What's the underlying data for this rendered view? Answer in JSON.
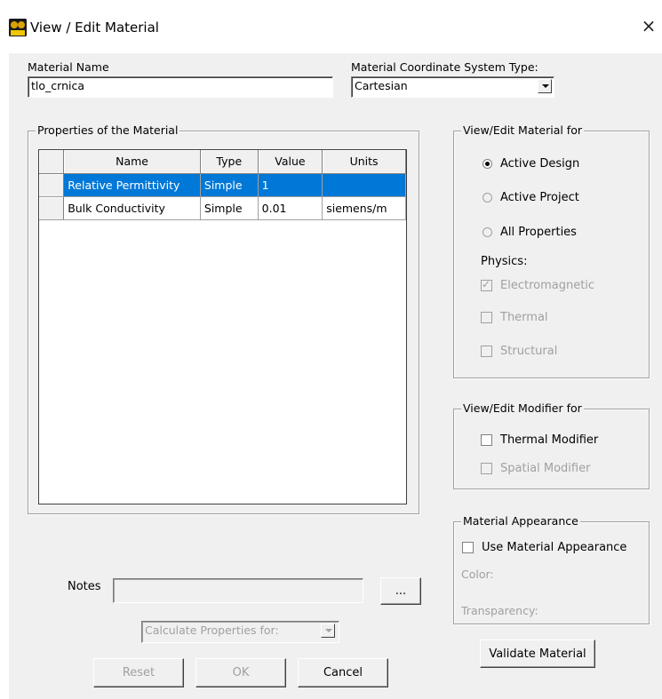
{
  "window": {
    "title": "View / Edit Material",
    "close_glyph": "×",
    "icon": "edt-app-icon"
  },
  "material_name": {
    "label": "Material Name",
    "value": "tlo_crnica"
  },
  "coordinate_system": {
    "label": "Material Coordinate System Type:",
    "value": "Cartesian"
  },
  "properties": {
    "group_title": "Properties of the Material",
    "columns": [
      "Name",
      "Type",
      "Value",
      "Units"
    ],
    "rows": [
      {
        "name": "Relative Permittivity",
        "type": "Simple",
        "value": "1",
        "units": "",
        "selected": true
      },
      {
        "name": "Bulk Conductivity",
        "type": "Simple",
        "value": "0.01",
        "units": "siemens/m",
        "selected": false
      }
    ]
  },
  "view_edit_material_for": {
    "title": "View/Edit Material for",
    "options": [
      "Active Design",
      "Active Project",
      "All Properties"
    ],
    "selected": "Active Design",
    "physics_label": "Physics:",
    "physics": [
      {
        "label": "Electromagnetic",
        "checked": true,
        "enabled": false
      },
      {
        "label": "Thermal",
        "checked": false,
        "enabled": false
      },
      {
        "label": "Structural",
        "checked": false,
        "enabled": false
      }
    ]
  },
  "view_edit_modifier_for": {
    "title": "View/Edit Modifier for",
    "thermal": "Thermal Modifier",
    "spatial": "Spatial Modifier"
  },
  "material_appearance": {
    "title": "Material Appearance",
    "use_label": "Use Material Appearance",
    "color_label": "Color:",
    "transparency_label": "Transparency:"
  },
  "notes": {
    "label": "Notes",
    "value": "",
    "browse_label": "..."
  },
  "calculate": {
    "value": "Calculate Properties for:"
  },
  "buttons": {
    "reset": "Reset",
    "ok": "OK",
    "cancel": "Cancel",
    "validate": "Validate Material"
  }
}
